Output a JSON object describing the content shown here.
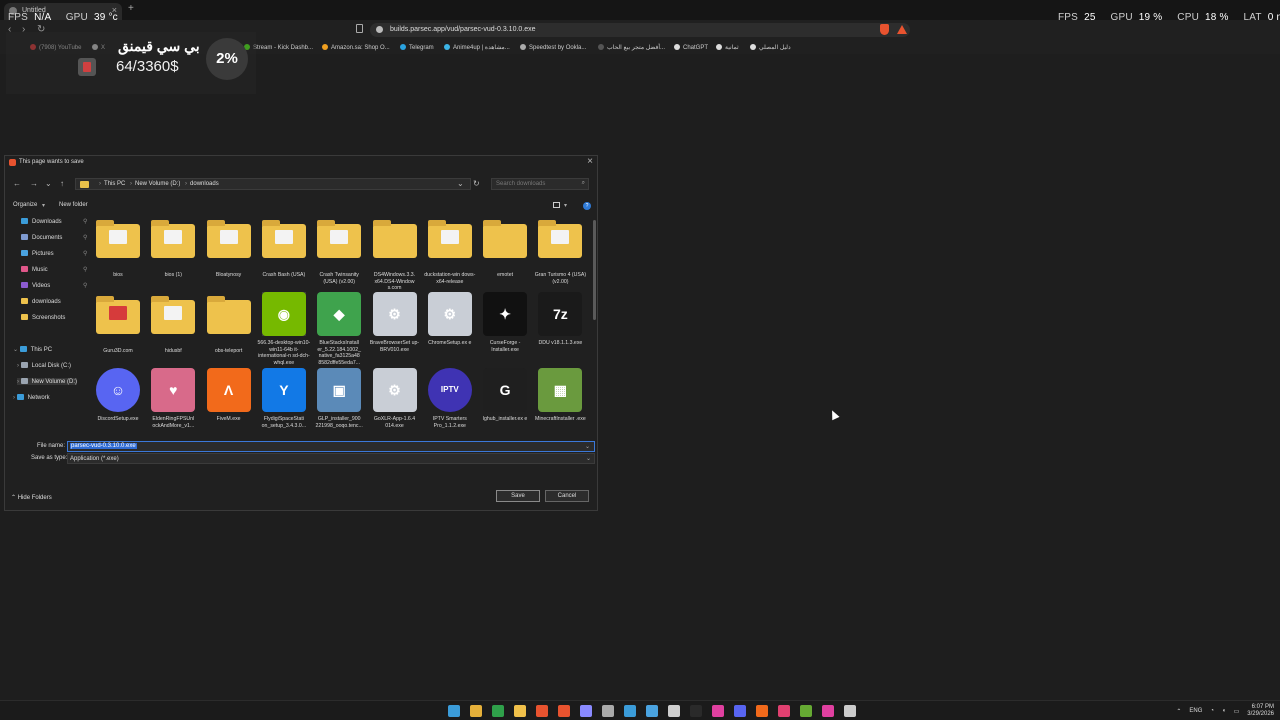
{
  "browser": {
    "tab_title": "Untitled",
    "address": "builds.parsec.app/vud/parsec-vud-0.3.10.0.exe",
    "bookmarks": [
      {
        "label": "(7908) YouTube",
        "color": "#e03b3b"
      },
      {
        "label": "X",
        "color": "#cfcfcf"
      },
      {
        "label": "Stream - Kick Dashb...",
        "color": "#53fc18"
      },
      {
        "label": "Amazon.sa: Shop O...",
        "color": "#f0a020"
      },
      {
        "label": "Telegram",
        "color": "#2aa3e0"
      },
      {
        "label": "Anime4up | مشاهدة...",
        "color": "#3cb4e6"
      },
      {
        "label": "Speedtest by Ookla...",
        "color": "#aaaaaa"
      },
      {
        "label": "أفضل متجر بيع الحاب...",
        "color": "#555555"
      },
      {
        "label": "ChatGPT",
        "color": "#dddddd"
      },
      {
        "label": "ثمانية",
        "color": "#dddddd"
      },
      {
        "label": "دليل المصلي",
        "color": "#dddddd"
      }
    ]
  },
  "overlay": {
    "fps_label": "FPS",
    "fps_value": "N/A",
    "gpu_temp_label": "GPU",
    "gpu_temp_value": "39 °c",
    "fps2_label": "FPS",
    "fps2_value": "25",
    "gpu_label": "GPU",
    "gpu_value": "19 %",
    "cpu_label": "CPU",
    "cpu_value": "18 %",
    "lat_label": "LAT",
    "lat_value": "0 ms"
  },
  "promo": {
    "arabic_text": "بي سي قيمنق",
    "amount": "64/3360$",
    "percent": "2%"
  },
  "dialog": {
    "title": "This page wants to save",
    "path": [
      "This PC",
      "New Volume (D:)",
      "downloads"
    ],
    "search_placeholder": "Search downloads",
    "organize": "Organize",
    "new_folder": "New folder",
    "sidebar": [
      {
        "label": "Downloads",
        "color": "#3b9cd9",
        "pinned": true
      },
      {
        "label": "Documents",
        "color": "#7f9bd1",
        "pinned": true
      },
      {
        "label": "Pictures",
        "color": "#4aa3e0",
        "pinned": true
      },
      {
        "label": "Music",
        "color": "#e0578a",
        "pinned": true
      },
      {
        "label": "Videos",
        "color": "#8c5bd0",
        "pinned": true
      },
      {
        "label": "downloads",
        "color": "#eec24c",
        "pinned": false
      },
      {
        "label": "Screenshots",
        "color": "#eec24c",
        "pinned": false
      }
    ],
    "tree": [
      {
        "label": "This PC",
        "color": "#3b9cd9"
      },
      {
        "label": "Local Disk (C:)",
        "color": "#9aa4b0"
      },
      {
        "label": "New Volume (D:)",
        "color": "#9aa4b0"
      },
      {
        "label": "Network",
        "color": "#3b9cd9"
      }
    ],
    "files": [
      {
        "name": "bios",
        "kind": "folder"
      },
      {
        "name": "bios (1)",
        "kind": "folder"
      },
      {
        "name": "Bloatynosy",
        "kind": "folder"
      },
      {
        "name": "Crash Bash (USA)",
        "kind": "folder"
      },
      {
        "name": "Crash Twinsanity (USA) (v2.00)",
        "kind": "folder"
      },
      {
        "name": "DS4Windows.3.3. x64.DS4-Window s.com",
        "kind": "folder-plain"
      },
      {
        "name": "duckstation-win dows-x64-release",
        "kind": "folder"
      },
      {
        "name": "emotet",
        "kind": "folder-plain"
      },
      {
        "name": "Gran Turismo 4 (USA) (v2.00)",
        "kind": "folder"
      },
      {
        "name": "Guru3D.com",
        "kind": "folder-red"
      },
      {
        "name": "hidusbf",
        "kind": "folder"
      },
      {
        "name": "obs-teleport",
        "kind": "folder-plain"
      },
      {
        "name": "566.36-desktop-win10-win11-64b it-international-n sd-dch-whql.exe",
        "kind": "app",
        "color": "#76b900",
        "glyph": "◉",
        "selected": true
      },
      {
        "name": "BlueStacksInstall er_5.22.184.1002_ native_fa3125a48 8582dffe55eda7...",
        "kind": "app",
        "color": "#3fa34d",
        "glyph": "◆"
      },
      {
        "name": "BraveBrowserSet up-BRV010.exe",
        "kind": "app",
        "color": "#c9ced6",
        "glyph": "⚙"
      },
      {
        "name": "ChromeSetup.ex e",
        "kind": "app",
        "color": "#c9ced6",
        "glyph": "⚙"
      },
      {
        "name": "CurseForge - Installer.exe",
        "kind": "app",
        "color": "#111111",
        "glyph": "✦"
      },
      {
        "name": "DDU v18.1.1.3.exe",
        "kind": "app",
        "color": "#1a1a1a",
        "glyph": "7z"
      },
      {
        "name": "DiscordSetup.exe",
        "kind": "app",
        "color": "#5865f2",
        "glyph": "☺"
      },
      {
        "name": "EldenRingFPSUnl ockAndMore_v1...",
        "kind": "app",
        "color": "#d86a8a",
        "glyph": "♥"
      },
      {
        "name": "FiveM.exe",
        "kind": "app",
        "color": "#f26a1b",
        "glyph": "Λ"
      },
      {
        "name": "FlydigiSpaceStati on_setup_3.4.3.0...",
        "kind": "app",
        "color": "#1279e6",
        "glyph": "Y"
      },
      {
        "name": "GLP_installer_900 221998_ooqo.tenc...",
        "kind": "app",
        "color": "#5b8ab8",
        "glyph": "▣"
      },
      {
        "name": "GoXLR-App-1.6.4 014.exe",
        "kind": "app",
        "color": "#c9ced6",
        "glyph": "⚙"
      },
      {
        "name": "IPTV Smarters Pro_1.1.2.exe",
        "kind": "app",
        "color": "#3f33b3",
        "glyph": "IPTV"
      },
      {
        "name": "lghub_installer.ex e",
        "kind": "app",
        "color": "#1f1f1f",
        "glyph": "G"
      },
      {
        "name": "MinecraftInstaller .exe",
        "kind": "app",
        "color": "#6a9a3e",
        "glyph": "▦"
      }
    ],
    "file_name_label": "File name:",
    "file_name_value": "parsec-vud-0.3.10.0.exe",
    "save_type_label": "Save as type:",
    "save_type_value": "Application (*.exe)",
    "hide_folders": "Hide Folders",
    "save": "Save",
    "cancel": "Cancel"
  },
  "taskbar": {
    "icons": [
      "#3b9cd9",
      "#e5b03a",
      "#2fa04a",
      "#f0c04a",
      "#e8532f",
      "#e8532f",
      "#8a8aff",
      "#aaaaaa",
      "#3b9cd9",
      "#4aa3e0",
      "#cfcfcf",
      "#2a2a2a",
      "#e040a0",
      "#5865f2",
      "#f26a1b",
      "#e04070",
      "#66aa33",
      "#e040a0",
      "#cccccc"
    ],
    "lang": "ENG",
    "time": "6:07 PM",
    "date": "3/29/2026"
  }
}
